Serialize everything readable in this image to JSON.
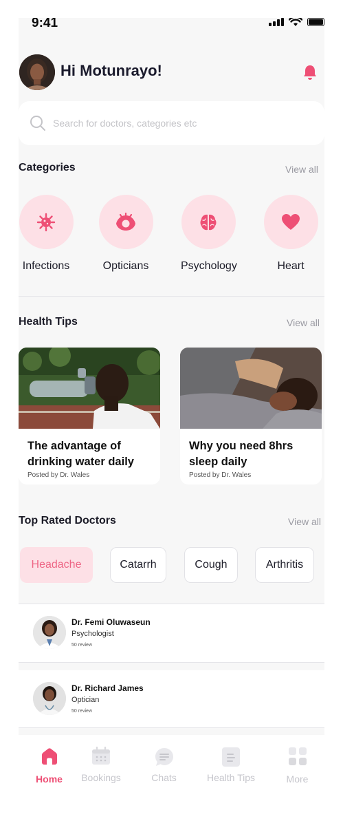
{
  "status": {
    "time": "9:41"
  },
  "user": {
    "greeting": "Hi Motunrayo!"
  },
  "search": {
    "placeholder": "Search for doctors, categories etc"
  },
  "categories": {
    "title": "Categories",
    "view_all": "View all",
    "items": [
      {
        "label": "Infections",
        "icon": "virus-icon"
      },
      {
        "label": "Opticians",
        "icon": "eye-icon"
      },
      {
        "label": "Psychology",
        "icon": "brain-icon"
      },
      {
        "label": "Heart",
        "icon": "heart-icon"
      }
    ]
  },
  "health_tips": {
    "title": "Health Tips",
    "view_all": "View all",
    "items": [
      {
        "title": "The advantage of drinking water daily",
        "author": "Posted by Dr. Wales"
      },
      {
        "title": "Why you need 8hrs sleep daily",
        "author": "Posted by Dr. Wales"
      }
    ]
  },
  "doctors": {
    "title": "Top Rated Doctors",
    "view_all": "View all",
    "filters": [
      "Headache",
      "Catarrh",
      "Cough",
      "Arthritis"
    ],
    "active_filter": "Headache",
    "items": [
      {
        "name": "Dr. Femi Oluwaseun",
        "specialty": "Psychologist",
        "reviews": "50 review"
      },
      {
        "name": "Dr. Richard James",
        "specialty": "Optician",
        "reviews": "50 review"
      }
    ]
  },
  "nav": {
    "items": [
      {
        "label": "Home",
        "icon": "home-icon"
      },
      {
        "label": "Bookings",
        "icon": "calendar-icon"
      },
      {
        "label": "Chats",
        "icon": "chat-icon"
      },
      {
        "label": "Health Tips",
        "icon": "document-icon"
      },
      {
        "label": "More",
        "icon": "grid-icon"
      }
    ],
    "active": "Home"
  },
  "colors": {
    "accent": "#ee4f75",
    "accent_light": "#fde0e6",
    "background": "#f7f7f7"
  }
}
